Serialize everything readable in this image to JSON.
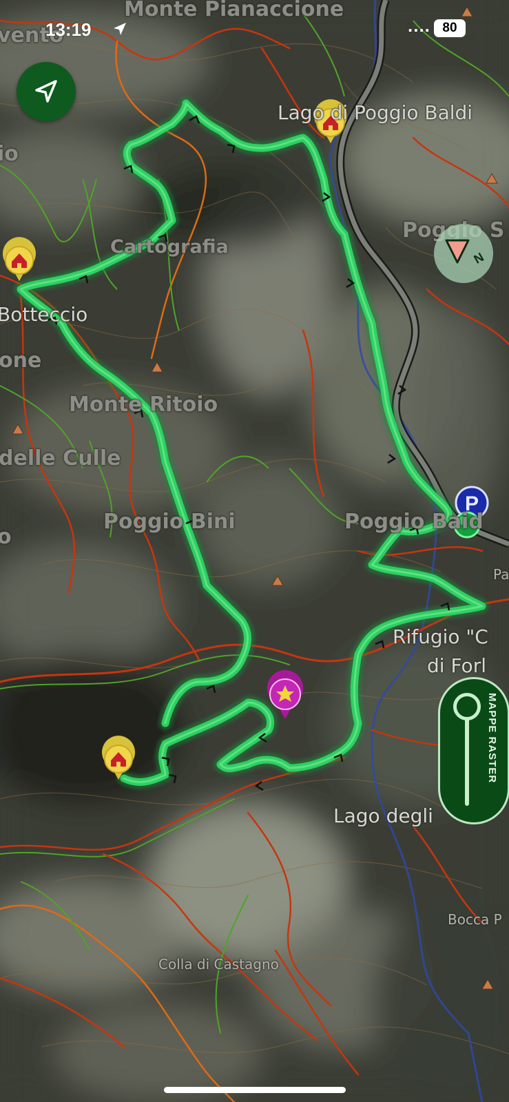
{
  "status_bar": {
    "time": "13:19",
    "battery": "80",
    "signal_dots": "...."
  },
  "map": {
    "place_labels": [
      {
        "text": "Monte Pianaccione",
        "kind": "big"
      },
      {
        "text": "vento",
        "kind": "big"
      },
      {
        "text": "Lago di Poggio Baldi",
        "kind": "mid"
      },
      {
        "text": "io",
        "kind": "big"
      },
      {
        "text": "Cartografia",
        "kind": "big"
      },
      {
        "text": "Poggio S",
        "kind": "big"
      },
      {
        "text": "Botteccio",
        "kind": "mid"
      },
      {
        "text": "one",
        "kind": "big"
      },
      {
        "text": "Monte Ritoio",
        "kind": "big"
      },
      {
        "text": "delle Culle",
        "kind": "big"
      },
      {
        "text": "Poggio Bini",
        "kind": "big"
      },
      {
        "text": "o",
        "kind": "big"
      },
      {
        "text": "Poggio Baid",
        "kind": "big"
      },
      {
        "text": "Pa",
        "kind": "small"
      },
      {
        "text": "Rifugio \"C",
        "kind": "mid"
      },
      {
        "text": "di Forl",
        "kind": "mid"
      },
      {
        "text": "Lago degli",
        "kind": "mid"
      },
      {
        "text": "Bocca P",
        "kind": "small"
      },
      {
        "text": "Colla di Castagno",
        "kind": "small"
      }
    ],
    "markers": {
      "shelter_icon": "house-icon",
      "start_point_icon": "star-icon",
      "parking_label": "P"
    },
    "colors": {
      "track": "#2fd565",
      "road_red": "#c8350d",
      "road_orange": "#e06a15",
      "trail_green": "#4ea428",
      "river": "#3048a8",
      "terrain_dark": "#3b3d35",
      "terrain_light": "#8a8e80"
    }
  },
  "controls": {
    "locate_icon": "navigation-arrow-icon",
    "compass_icon": "compass-icon",
    "compass_letter": "N",
    "raster_toggle_label": "MAPPE RASTER"
  }
}
